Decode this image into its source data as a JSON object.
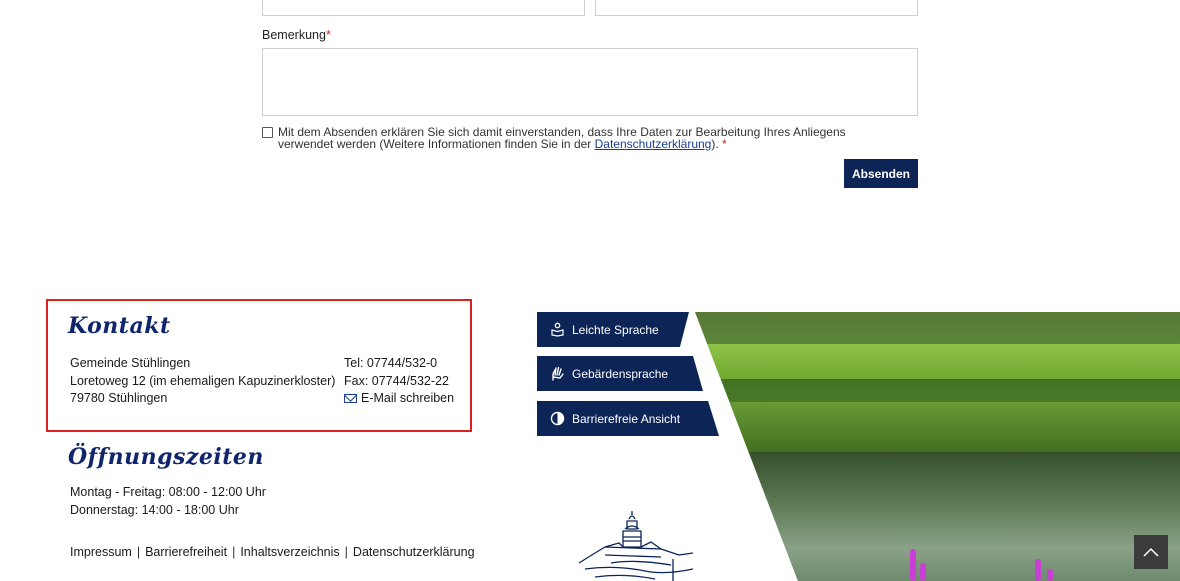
{
  "form": {
    "remark_label": "Bemerkung",
    "required_mark": "*",
    "consent_text_before": "Mit dem Absenden erklären Sie sich damit einverstanden, dass Ihre Daten zur Bearbeitung Ihres Anliegens verwendet werden (Weitere Informationen finden Sie in der ",
    "consent_link": "Datenschutzerklärung",
    "consent_text_after": ").",
    "submit_label": "Absenden"
  },
  "contact": {
    "heading": "Kontakt",
    "address": [
      "Gemeinde Stühlingen",
      "Loretoweg 12 (im ehemaligen Kapuzinerkloster)",
      "79780 Stühlingen"
    ],
    "tel": "Tel: 07744/532-0",
    "fax": "Fax: 07744/532-22",
    "email_label": "E-Mail schreiben"
  },
  "hours": {
    "heading": "Öffnungszeiten",
    "lines": [
      "Montag - Freitag: 08:00 - 12:00 Uhr",
      "Donnerstag: 14:00 - 18:00 Uhr"
    ]
  },
  "footer_links": [
    "Impressum",
    "Barrierefreiheit",
    "Inhaltsverzeichnis",
    "Datenschutzerklärung"
  ],
  "accessibility": {
    "easy_language": "Leichte Sprache",
    "sign_language": "Gebärdensprache",
    "accessible_view": "Barrierefreie Ansicht"
  },
  "colors": {
    "navy": "#0c2456",
    "script_blue": "#10256b",
    "highlight_red": "#e0201e",
    "required_red": "#c62828"
  }
}
